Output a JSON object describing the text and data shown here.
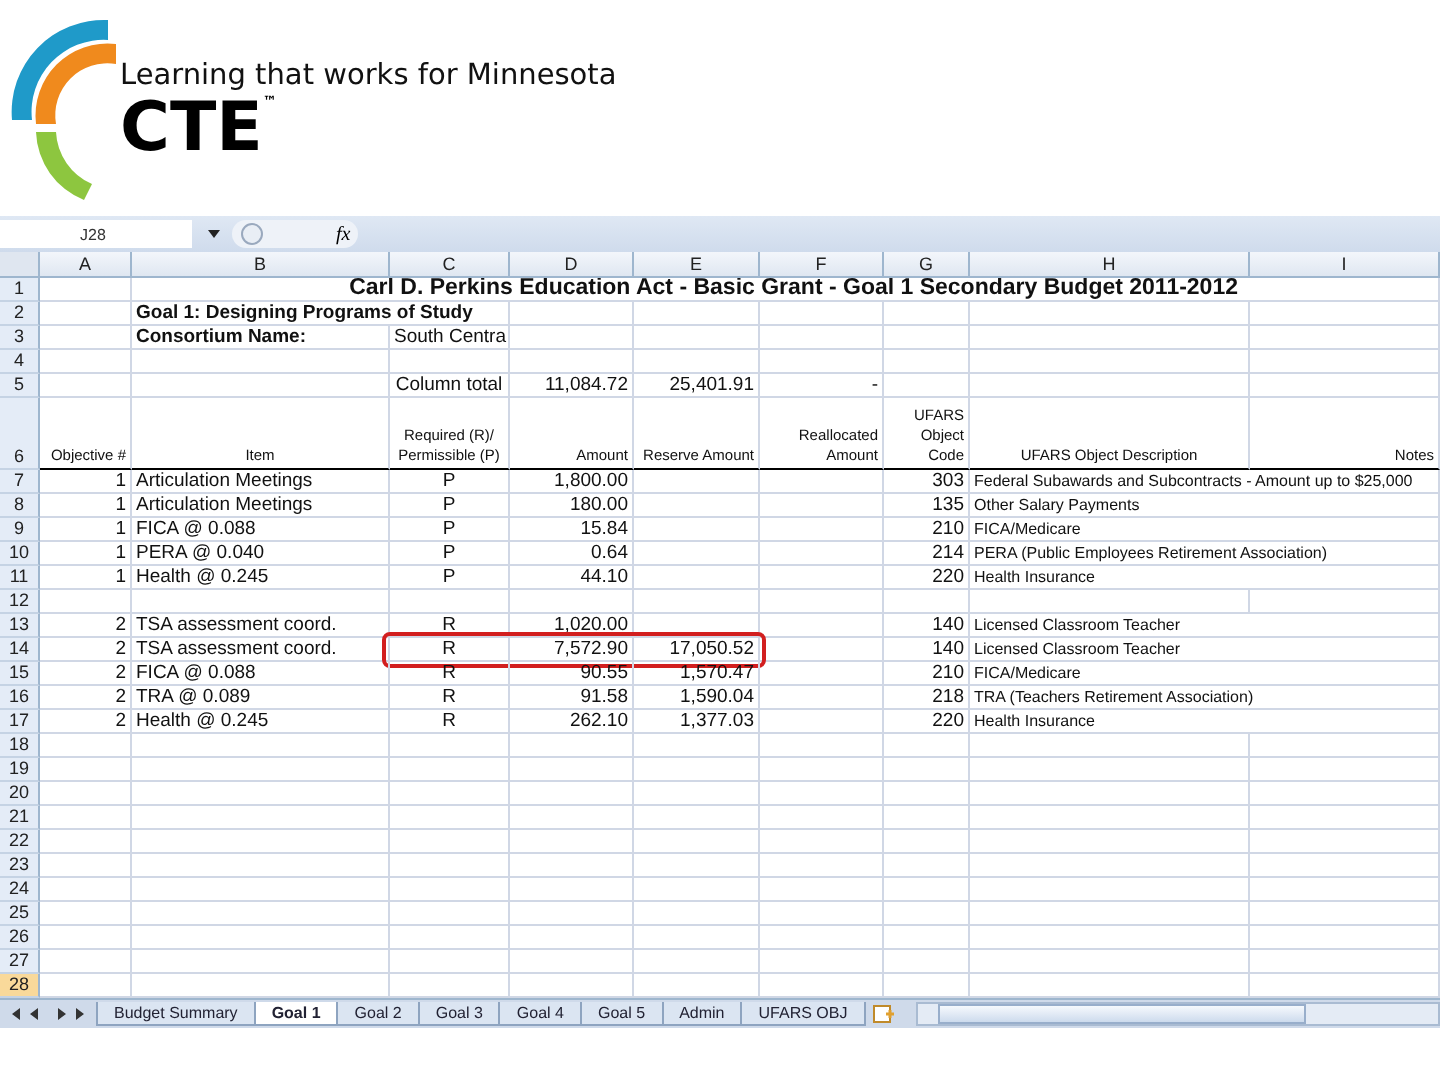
{
  "logo": {
    "tagline": "Learning that works for Minnesota",
    "wordmark": "CTE$^{™}$"
  },
  "formula_bar": {
    "name_box": "J28",
    "function_label": "fx"
  },
  "columns": [
    {
      "label": "A"
    },
    {
      "label": "B"
    },
    {
      "label": "C"
    },
    {
      "label": "D"
    },
    {
      "label": "E"
    },
    {
      "label": "F"
    },
    {
      "label": "G"
    },
    {
      "label": "H"
    },
    {
      "label": "I"
    }
  ],
  "rows": [
    {
      "num": "1",
      "kind": "title",
      "selected": false,
      "highlighted": false,
      "title": "Carl D. Perkins Education Act - Basic Grant - Goal 1 Secondary Budget  2011-2012"
    },
    {
      "num": "2",
      "kind": "label",
      "selected": false,
      "highlighted": false,
      "B": "Goal 1: Designing Programs of Study"
    },
    {
      "num": "3",
      "kind": "label",
      "selected": false,
      "highlighted": false,
      "B": "Consortium Name:",
      "C": "South Centra"
    },
    {
      "num": "4",
      "kind": "data",
      "selected": false,
      "highlighted": false
    },
    {
      "num": "5",
      "kind": "data",
      "selected": false,
      "highlighted": false,
      "C": "Column total",
      "D": "11,084.72",
      "E": "25,401.91",
      "F": "-"
    },
    {
      "num": "6",
      "kind": "header",
      "selected": false,
      "highlighted": false,
      "A": "Objective #",
      "B": "Item",
      "C": "Required (R)/ Permissible (P)",
      "D": "Amount",
      "E": "Reserve Amount",
      "F": "Reallocated Amount",
      "G": "UFARS Object Code",
      "H": "UFARS Object Description",
      "I": "Notes"
    },
    {
      "num": "7",
      "kind": "data",
      "selected": false,
      "highlighted": false,
      "A": "1",
      "B": "Articulation Meetings",
      "C": "P",
      "D": "1,800.00",
      "G": "303",
      "H": "Federal Subawards and Subcontracts - Amount up to $25,000"
    },
    {
      "num": "8",
      "kind": "data",
      "selected": false,
      "highlighted": false,
      "A": "1",
      "B": "Articulation Meetings",
      "C": "P",
      "D": "180.00",
      "G": "135",
      "H": "Other Salary Payments"
    },
    {
      "num": "9",
      "kind": "data",
      "selected": false,
      "highlighted": false,
      "A": "1",
      "B": "FICA @ 0.088",
      "C": "P",
      "D": "15.84",
      "G": "210",
      "H": "FICA/Medicare"
    },
    {
      "num": "10",
      "kind": "data",
      "selected": false,
      "highlighted": false,
      "A": "1",
      "B": "PERA @ 0.040",
      "C": "P",
      "D": "0.64",
      "G": "214",
      "H": "PERA (Public Employees Retirement Association)"
    },
    {
      "num": "11",
      "kind": "data",
      "selected": false,
      "highlighted": false,
      "A": "1",
      "B": "Health @ 0.245",
      "C": "P",
      "D": "44.10",
      "G": "220",
      "H": "Health Insurance"
    },
    {
      "num": "12",
      "kind": "data",
      "selected": false,
      "highlighted": false
    },
    {
      "num": "13",
      "kind": "data",
      "selected": false,
      "highlighted": false,
      "A": "2",
      "B": "TSA assessment coord.",
      "C": "R",
      "D": "1,020.00",
      "G": "140",
      "H": "Licensed Classroom Teacher"
    },
    {
      "num": "14",
      "kind": "data",
      "selected": false,
      "highlighted": true,
      "A": "2",
      "B": "TSA assessment coord.",
      "C": "R",
      "D": "7,572.90",
      "E": "17,050.52",
      "G": "140",
      "H": "Licensed Classroom Teacher"
    },
    {
      "num": "15",
      "kind": "data",
      "selected": false,
      "highlighted": false,
      "A": "2",
      "B": "FICA @ 0.088",
      "C": "R",
      "D": "90.55",
      "E": "1,570.47",
      "G": "210",
      "H": "FICA/Medicare"
    },
    {
      "num": "16",
      "kind": "data",
      "selected": false,
      "highlighted": false,
      "A": "2",
      "B": "TRA @ 0.089",
      "C": "R",
      "D": "91.58",
      "E": "1,590.04",
      "G": "218",
      "H": "TRA (Teachers Retirement Association)"
    },
    {
      "num": "17",
      "kind": "data",
      "selected": false,
      "highlighted": false,
      "A": "2",
      "B": "Health @ 0.245",
      "C": "R",
      "D": "262.10",
      "E": "1,377.03",
      "G": "220",
      "H": "Health Insurance"
    },
    {
      "num": "18",
      "kind": "data",
      "selected": false,
      "highlighted": false
    },
    {
      "num": "19",
      "kind": "data",
      "selected": false,
      "highlighted": false
    },
    {
      "num": "20",
      "kind": "data",
      "selected": false,
      "highlighted": false
    },
    {
      "num": "21",
      "kind": "data",
      "selected": false,
      "highlighted": false
    },
    {
      "num": "22",
      "kind": "data",
      "selected": false,
      "highlighted": false
    },
    {
      "num": "23",
      "kind": "data",
      "selected": false,
      "highlighted": false
    },
    {
      "num": "24",
      "kind": "data",
      "selected": false,
      "highlighted": false
    },
    {
      "num": "25",
      "kind": "data",
      "selected": false,
      "highlighted": false
    },
    {
      "num": "26",
      "kind": "data",
      "selected": false,
      "highlighted": false
    },
    {
      "num": "27",
      "kind": "data",
      "selected": false,
      "highlighted": false
    },
    {
      "num": "28",
      "kind": "data",
      "selected": true,
      "highlighted": false
    }
  ],
  "sheet_tabs": [
    {
      "label": "Budget Summary",
      "selected": false
    },
    {
      "label": "Goal 1",
      "selected": true
    },
    {
      "label": "Goal 2",
      "selected": false
    },
    {
      "label": "Goal 3",
      "selected": false
    },
    {
      "label": "Goal 4",
      "selected": false
    },
    {
      "label": "Goal 5",
      "selected": false
    },
    {
      "label": "Admin",
      "selected": false
    },
    {
      "label": "UFARS OBJ",
      "selected": false
    }
  ]
}
